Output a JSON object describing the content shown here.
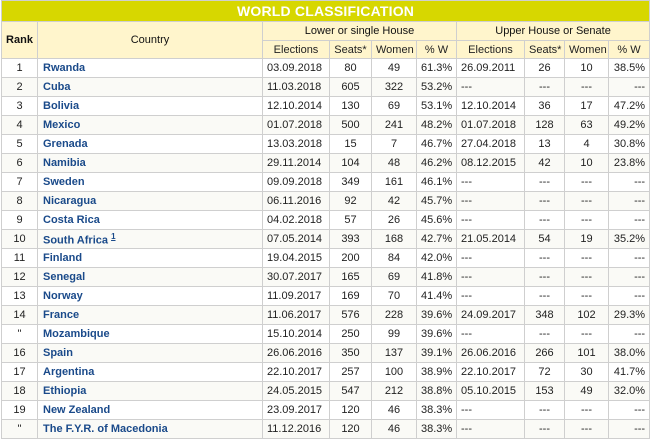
{
  "title": "WORLD CLASSIFICATION",
  "headers": {
    "rank": "Rank",
    "country": "Country",
    "lower_group": "Lower or single House",
    "upper_group": "Upper House or Senate",
    "elections": "Elections",
    "seats": "Seats*",
    "women": "Women",
    "pct_w": "% W"
  },
  "rows": [
    {
      "rank": "1",
      "country": "Rwanda",
      "note": "",
      "l_elections": "03.09.2018",
      "l_seats": "80",
      "l_women": "49",
      "l_pct": "61.3%",
      "u_elections": "26.09.2011",
      "u_seats": "26",
      "u_women": "10",
      "u_pct": "38.5%"
    },
    {
      "rank": "2",
      "country": "Cuba",
      "note": "",
      "l_elections": "11.03.2018",
      "l_seats": "605",
      "l_women": "322",
      "l_pct": "53.2%",
      "u_elections": "---",
      "u_seats": "---",
      "u_women": "---",
      "u_pct": "---"
    },
    {
      "rank": "3",
      "country": "Bolivia",
      "note": "",
      "l_elections": "12.10.2014",
      "l_seats": "130",
      "l_women": "69",
      "l_pct": "53.1%",
      "u_elections": "12.10.2014",
      "u_seats": "36",
      "u_women": "17",
      "u_pct": "47.2%"
    },
    {
      "rank": "4",
      "country": "Mexico",
      "note": "",
      "l_elections": "01.07.2018",
      "l_seats": "500",
      "l_women": "241",
      "l_pct": "48.2%",
      "u_elections": "01.07.2018",
      "u_seats": "128",
      "u_women": "63",
      "u_pct": "49.2%"
    },
    {
      "rank": "5",
      "country": "Grenada",
      "note": "",
      "l_elections": "13.03.2018",
      "l_seats": "15",
      "l_women": "7",
      "l_pct": "46.7%",
      "u_elections": "27.04.2018",
      "u_seats": "13",
      "u_women": "4",
      "u_pct": "30.8%"
    },
    {
      "rank": "6",
      "country": "Namibia",
      "note": "",
      "l_elections": "29.11.2014",
      "l_seats": "104",
      "l_women": "48",
      "l_pct": "46.2%",
      "u_elections": "08.12.2015",
      "u_seats": "42",
      "u_women": "10",
      "u_pct": "23.8%"
    },
    {
      "rank": "7",
      "country": "Sweden",
      "note": "",
      "l_elections": "09.09.2018",
      "l_seats": "349",
      "l_women": "161",
      "l_pct": "46.1%",
      "u_elections": "---",
      "u_seats": "---",
      "u_women": "---",
      "u_pct": "---"
    },
    {
      "rank": "8",
      "country": "Nicaragua",
      "note": "",
      "l_elections": "06.11.2016",
      "l_seats": "92",
      "l_women": "42",
      "l_pct": "45.7%",
      "u_elections": "---",
      "u_seats": "---",
      "u_women": "---",
      "u_pct": "---"
    },
    {
      "rank": "9",
      "country": "Costa Rica",
      "note": "",
      "l_elections": "04.02.2018",
      "l_seats": "57",
      "l_women": "26",
      "l_pct": "45.6%",
      "u_elections": "---",
      "u_seats": "---",
      "u_women": "---",
      "u_pct": "---"
    },
    {
      "rank": "10",
      "country": "South Africa",
      "note": "1",
      "l_elections": "07.05.2014",
      "l_seats": "393",
      "l_women": "168",
      "l_pct": "42.7%",
      "u_elections": "21.05.2014",
      "u_seats": "54",
      "u_women": "19",
      "u_pct": "35.2%"
    },
    {
      "rank": "11",
      "country": "Finland",
      "note": "",
      "l_elections": "19.04.2015",
      "l_seats": "200",
      "l_women": "84",
      "l_pct": "42.0%",
      "u_elections": "---",
      "u_seats": "---",
      "u_women": "---",
      "u_pct": "---"
    },
    {
      "rank": "12",
      "country": "Senegal",
      "note": "",
      "l_elections": "30.07.2017",
      "l_seats": "165",
      "l_women": "69",
      "l_pct": "41.8%",
      "u_elections": "---",
      "u_seats": "---",
      "u_women": "---",
      "u_pct": "---"
    },
    {
      "rank": "13",
      "country": "Norway",
      "note": "",
      "l_elections": "11.09.2017",
      "l_seats": "169",
      "l_women": "70",
      "l_pct": "41.4%",
      "u_elections": "---",
      "u_seats": "---",
      "u_women": "---",
      "u_pct": "---"
    },
    {
      "rank": "14",
      "country": "France",
      "note": "",
      "l_elections": "11.06.2017",
      "l_seats": "576",
      "l_women": "228",
      "l_pct": "39.6%",
      "u_elections": "24.09.2017",
      "u_seats": "348",
      "u_women": "102",
      "u_pct": "29.3%"
    },
    {
      "rank": "\"",
      "country": "Mozambique",
      "note": "",
      "l_elections": "15.10.2014",
      "l_seats": "250",
      "l_women": "99",
      "l_pct": "39.6%",
      "u_elections": "---",
      "u_seats": "---",
      "u_women": "---",
      "u_pct": "---"
    },
    {
      "rank": "16",
      "country": "Spain",
      "note": "",
      "l_elections": "26.06.2016",
      "l_seats": "350",
      "l_women": "137",
      "l_pct": "39.1%",
      "u_elections": "26.06.2016",
      "u_seats": "266",
      "u_women": "101",
      "u_pct": "38.0%"
    },
    {
      "rank": "17",
      "country": "Argentina",
      "note": "",
      "l_elections": "22.10.2017",
      "l_seats": "257",
      "l_women": "100",
      "l_pct": "38.9%",
      "u_elections": "22.10.2017",
      "u_seats": "72",
      "u_women": "30",
      "u_pct": "41.7%"
    },
    {
      "rank": "18",
      "country": "Ethiopia",
      "note": "",
      "l_elections": "24.05.2015",
      "l_seats": "547",
      "l_women": "212",
      "l_pct": "38.8%",
      "u_elections": "05.10.2015",
      "u_seats": "153",
      "u_women": "49",
      "u_pct": "32.0%"
    },
    {
      "rank": "19",
      "country": "New Zealand",
      "note": "",
      "l_elections": "23.09.2017",
      "l_seats": "120",
      "l_women": "46",
      "l_pct": "38.3%",
      "u_elections": "---",
      "u_seats": "---",
      "u_women": "---",
      "u_pct": "---"
    },
    {
      "rank": "\"",
      "country": "The F.Y.R. of Macedonia",
      "note": "",
      "l_elections": "11.12.2016",
      "l_seats": "120",
      "l_women": "46",
      "l_pct": "38.3%",
      "u_elections": "---",
      "u_seats": "---",
      "u_women": "---",
      "u_pct": "---"
    }
  ]
}
